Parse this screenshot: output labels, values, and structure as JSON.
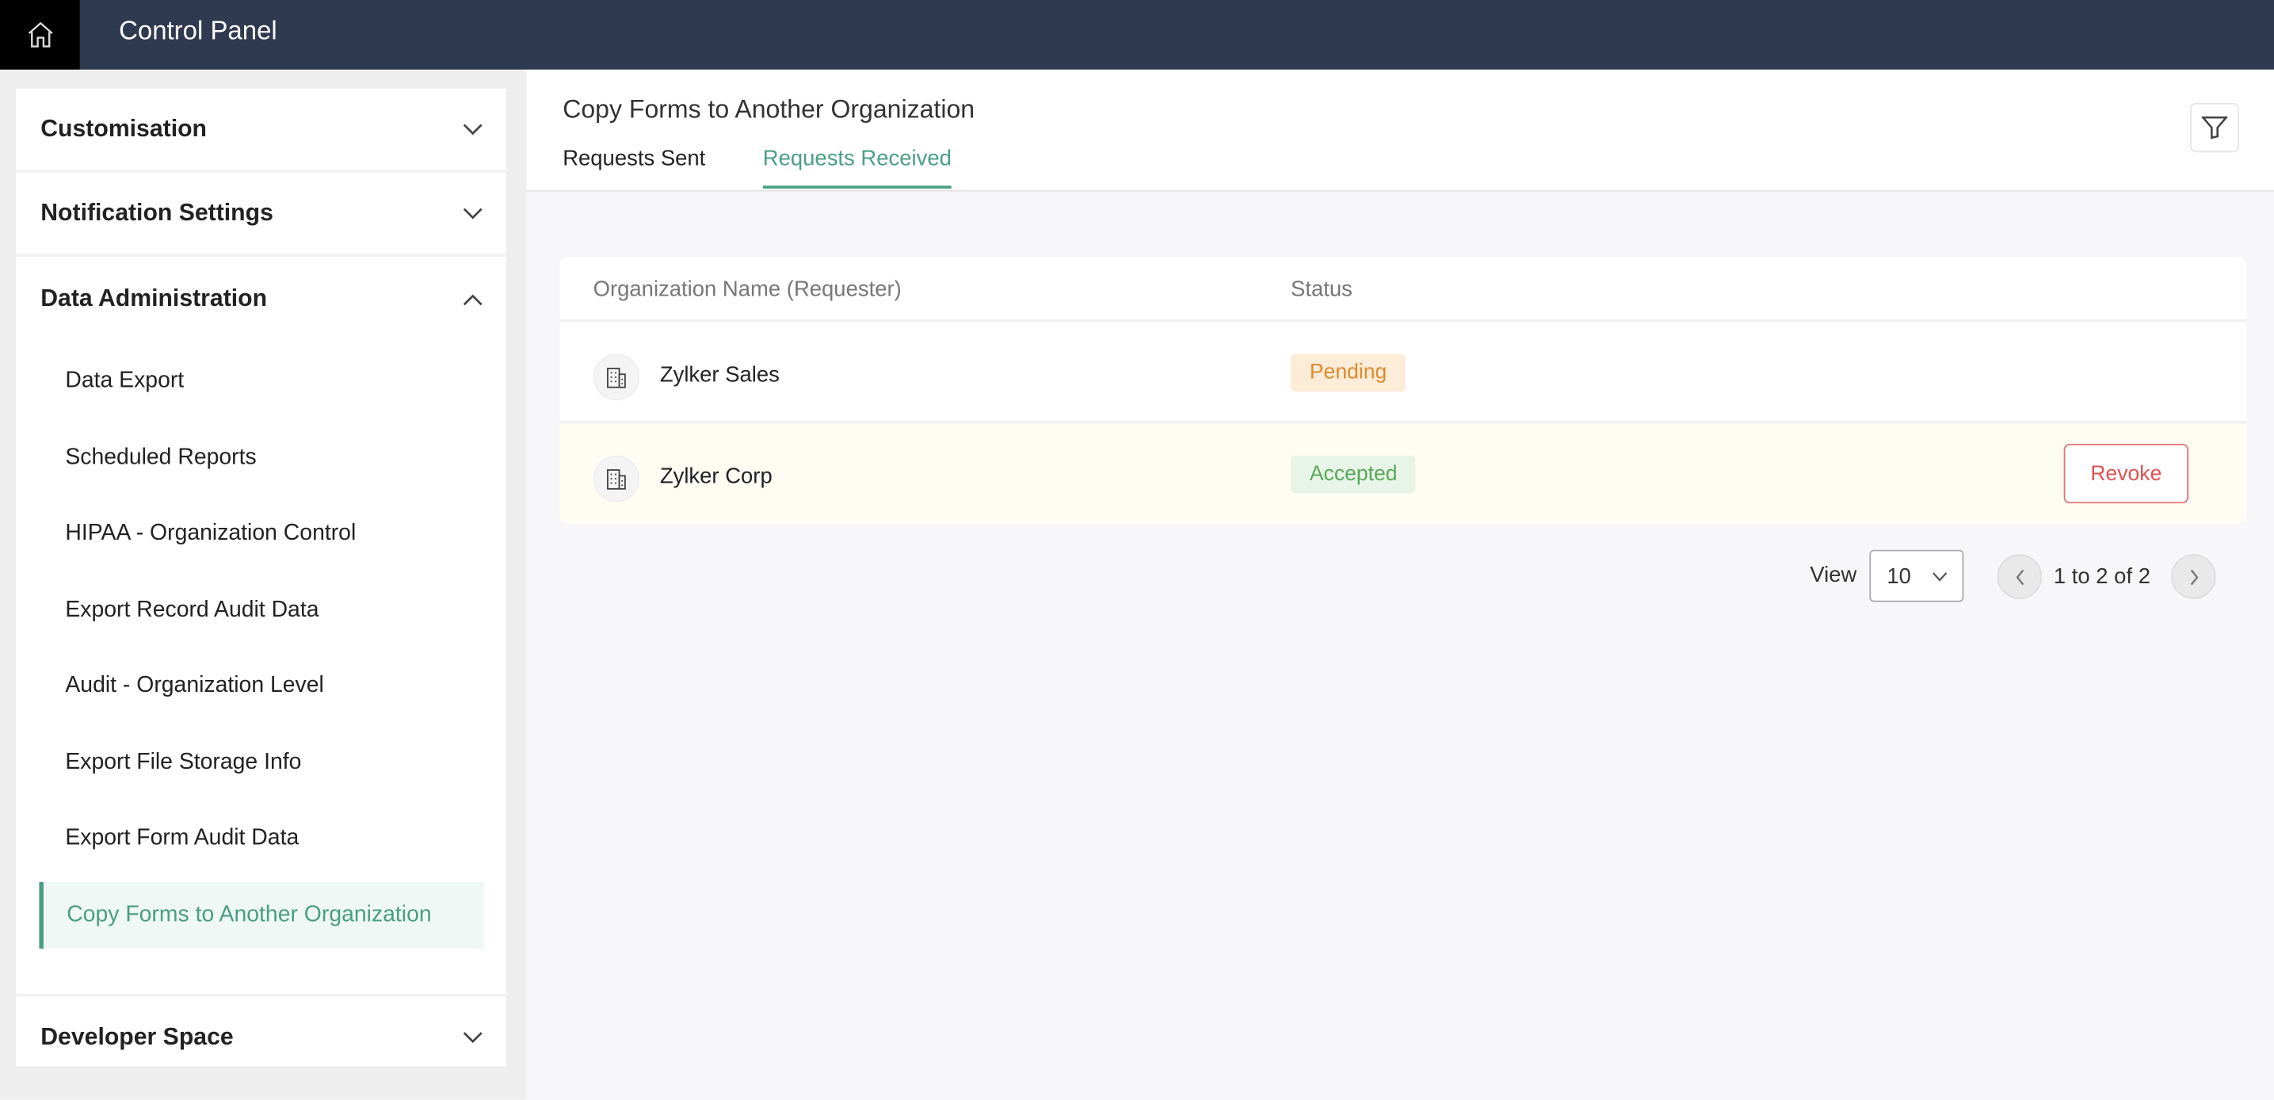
{
  "header": {
    "title": "Control Panel",
    "home_icon": "home-icon"
  },
  "sidebar": {
    "sections": [
      {
        "label": "Customisation",
        "expanded": false
      },
      {
        "label": "Notification Settings",
        "expanded": false
      },
      {
        "label": "Data Administration",
        "expanded": true,
        "items": [
          "Data Export",
          "Scheduled Reports",
          "HIPAA - Organization Control",
          "Export Record Audit Data",
          "Audit - Organization Level",
          "Export File Storage Info",
          "Export Form Audit Data",
          "Copy Forms to Another Organization"
        ],
        "active_item": "Copy Forms to Another Organization"
      },
      {
        "label": "Developer Space",
        "expanded": false
      }
    ]
  },
  "main": {
    "title": "Copy Forms to Another Organization",
    "tabs": [
      {
        "label": "Requests Sent",
        "active": false
      },
      {
        "label": "Requests Received",
        "active": true
      }
    ],
    "table": {
      "columns": [
        "Organization Name (Requester)",
        "Status"
      ],
      "rows": [
        {
          "name": "Zylker Sales",
          "status": "Pending"
        },
        {
          "name": "Zylker Corp",
          "status": "Accepted",
          "action": "Revoke"
        }
      ]
    },
    "pagination": {
      "view_label": "View",
      "page_size": "10",
      "range": "1 to 2 of 2"
    }
  },
  "colors": {
    "accent": "#4a9f82",
    "topbar": "#2f3950",
    "pending": "#e08a2d",
    "accepted": "#5aa85a",
    "revoke": "#e05252"
  }
}
